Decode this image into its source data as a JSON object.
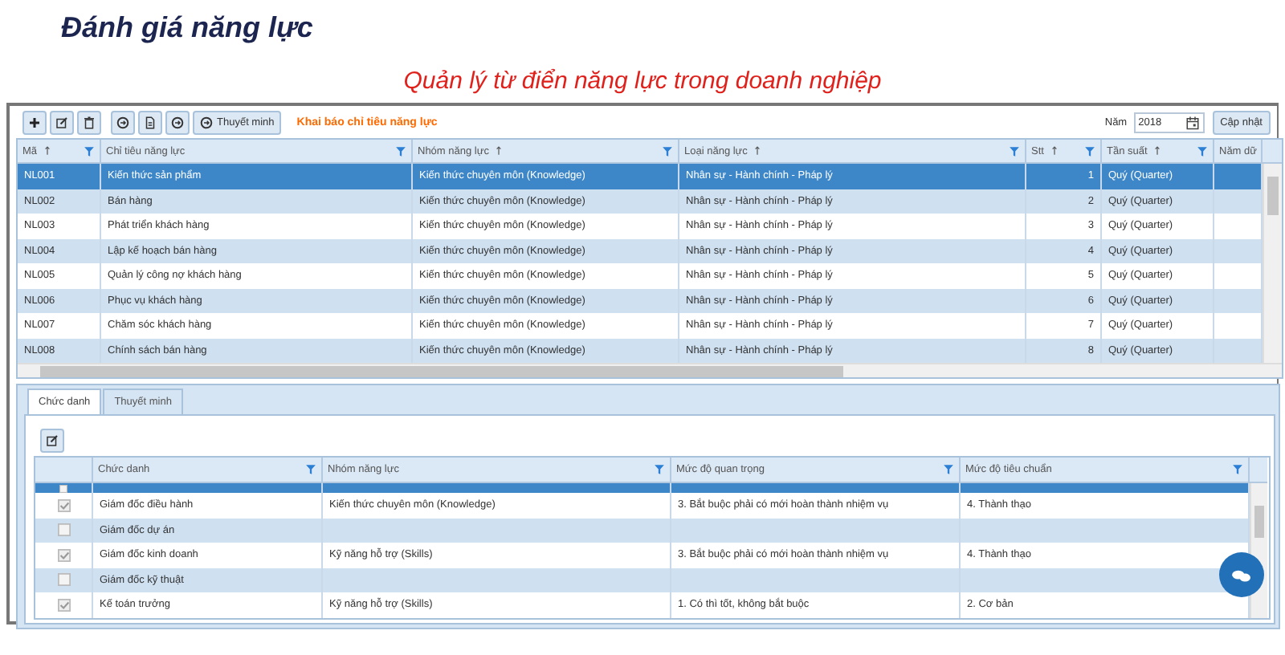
{
  "page": {
    "title": "Đánh giá năng lực",
    "subtitle": "Quản lý từ điển năng lực trong doanh nghiệp"
  },
  "toolbar": {
    "explain_button": "Thuyết minh",
    "section_label": "Khai báo chỉ tiêu năng lực",
    "year_label": "Năm",
    "year_value": "2018",
    "update_button": "Cập nhật"
  },
  "main_table": {
    "columns": [
      {
        "label": "Mã",
        "kind": "text",
        "sortable": true,
        "filter": true
      },
      {
        "label": "Chỉ tiêu năng lực",
        "kind": "text",
        "sortable": false,
        "filter": true
      },
      {
        "label": "Nhóm năng lực",
        "kind": "text",
        "sortable": true,
        "filter": true
      },
      {
        "label": "Loại năng lực",
        "kind": "text",
        "sortable": true,
        "filter": true
      },
      {
        "label": "Stt",
        "kind": "number",
        "sortable": true,
        "filter": true
      },
      {
        "label": "Tần suất",
        "kind": "text",
        "sortable": true,
        "filter": true
      },
      {
        "label": "Năm dữ",
        "kind": "text"
      }
    ],
    "rows": [
      {
        "selected": true,
        "cells": [
          "NL001",
          "Kiến thức sản phẩm",
          "Kiến thức chuyên môn (Knowledge)",
          "Nhân sự - Hành chính - Pháp lý",
          "1",
          "Quý (Quarter)"
        ]
      },
      {
        "selected": false,
        "cells": [
          "NL002",
          "Bán hàng",
          "Kiến thức chuyên môn (Knowledge)",
          "Nhân sự - Hành chính - Pháp lý",
          "2",
          "Quý (Quarter)"
        ]
      },
      {
        "selected": false,
        "cells": [
          "NL003",
          "Phát triển khách hàng",
          "Kiến thức chuyên môn (Knowledge)",
          "Nhân sự - Hành chính - Pháp lý",
          "3",
          "Quý (Quarter)"
        ]
      },
      {
        "selected": false,
        "cells": [
          "NL004",
          "Lập kế hoạch bán hàng",
          "Kiến thức chuyên môn (Knowledge)",
          "Nhân sự - Hành chính - Pháp lý",
          "4",
          "Quý (Quarter)"
        ]
      },
      {
        "selected": false,
        "cells": [
          "NL005",
          "Quản lý công nợ khách hàng",
          "Kiến thức chuyên môn (Knowledge)",
          "Nhân sự - Hành chính - Pháp lý",
          "5",
          "Quý (Quarter)"
        ]
      },
      {
        "selected": false,
        "cells": [
          "NL006",
          "Phục vụ khách hàng",
          "Kiến thức chuyên môn (Knowledge)",
          "Nhân sự - Hành chính - Pháp lý",
          "6",
          "Quý (Quarter)"
        ]
      },
      {
        "selected": false,
        "cells": [
          "NL007",
          "Chăm sóc khách hàng",
          "Kiến thức chuyên môn (Knowledge)",
          "Nhân sự - Hành chính - Pháp lý",
          "7",
          "Quý (Quarter)"
        ]
      },
      {
        "selected": false,
        "cells": [
          "NL008",
          "Chính sách bán hàng",
          "Kiến thức chuyên môn (Knowledge)",
          "Nhân sự - Hành chính - Pháp lý",
          "8",
          "Quý (Quarter)"
        ]
      }
    ]
  },
  "detail": {
    "tabs": [
      {
        "label": "Chức danh",
        "selected": true
      },
      {
        "label": "Thuyết minh",
        "selected": false
      }
    ],
    "columns": [
      {
        "label": "Chức danh",
        "filter": true
      },
      {
        "label": "Nhóm năng lực",
        "filter": true
      },
      {
        "label": "Mức độ quan trọng",
        "filter": true
      },
      {
        "label": "Mức độ tiêu chuẩn",
        "filter": true
      }
    ],
    "rows": [
      {
        "selected": true,
        "checked": false,
        "cells": []
      },
      {
        "selected": false,
        "checked": true,
        "cells": [
          "Giám đốc điều hành",
          "Kiến thức chuyên môn (Knowledge)",
          "3. Bắt buộc phải có mới hoàn thành nhiệm vụ",
          "4. Thành thạo"
        ]
      },
      {
        "selected": false,
        "checked": false,
        "cells": [
          "Giám đốc dự án"
        ]
      },
      {
        "selected": false,
        "checked": true,
        "cells": [
          "Giám đốc kinh doanh",
          "Kỹ năng hỗ trợ (Skills)",
          "3. Bắt buộc phải có mới hoàn thành nhiệm vụ",
          "4. Thành thạo"
        ]
      },
      {
        "selected": false,
        "checked": false,
        "cells": [
          "Giám đốc kỹ thuật"
        ]
      },
      {
        "selected": false,
        "checked": true,
        "cells": [
          "Kế toán trưởng",
          "Kỹ năng hỗ trợ (Skills)",
          "1. Có thì tốt, không bắt buộc",
          "2. Cơ bản"
        ]
      }
    ]
  }
}
